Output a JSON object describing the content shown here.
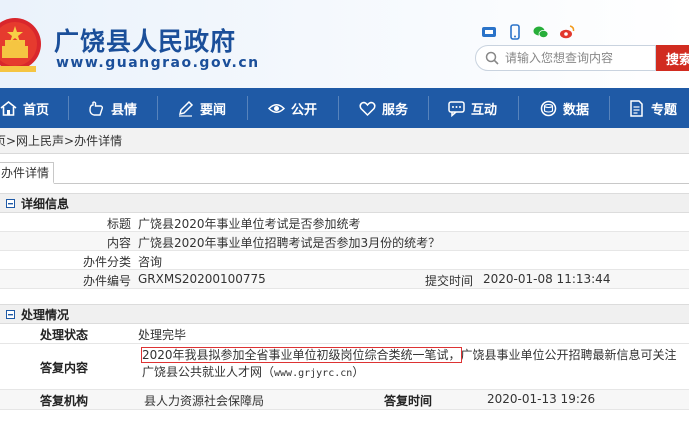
{
  "header": {
    "title": "广饶县人民政府",
    "url": "www.guangrao.gov.cn",
    "search_placeholder": "请输入您想查询内容",
    "search_button": "搜索"
  },
  "nav": [
    {
      "label": "首页",
      "icon": "home-icon"
    },
    {
      "label": "县情",
      "icon": "hand-icon"
    },
    {
      "label": "要闻",
      "icon": "pencil-icon"
    },
    {
      "label": "公开",
      "icon": "eye-icon"
    },
    {
      "label": "服务",
      "icon": "heart-icon"
    },
    {
      "label": "互动",
      "icon": "chat-icon"
    },
    {
      "label": "数据",
      "icon": "data-icon"
    },
    {
      "label": "专题",
      "icon": "document-icon"
    }
  ],
  "breadcrumb": "页>网上民声>办件详情",
  "detail_tab": "办件详情",
  "detail": {
    "section_title": "详细信息",
    "title_label": "标题",
    "title_value": "广饶县2020年事业单位考试是否参加统考",
    "content_label": "内容",
    "content_value": "广饶县2020年事业单位招聘考试是否参加3月份的统考？",
    "category_label": "办件分类",
    "category_value": "咨询",
    "number_label": "办件编号",
    "number_value": "GRXMS20200100775",
    "submit_label": "提交时间",
    "submit_value": "2020-01-08 11:13:44"
  },
  "handling": {
    "section_title": "处理情况",
    "status_label": "处理状态",
    "status_value": "处理完毕",
    "answer_label": "答复内容",
    "answer_highlight": "2020年我县拟参加全省事业单位初级岗位综合类统一笔试，",
    "answer_rest": "广饶县事业单位公开招聘最新信息可关注广饶县公共就业人才网（",
    "answer_url": "www.grjyrc.cn",
    "answer_end": "）",
    "agency_label": "答复机构",
    "agency_value": "县人力资源社会保障局",
    "reply_time_label": "答复时间",
    "reply_time_value": "2020-01-13 19:26"
  },
  "colors": {
    "brand_blue": "#1f5aa6",
    "title_blue": "#1b4f9a",
    "search_red": "#d12c20"
  }
}
